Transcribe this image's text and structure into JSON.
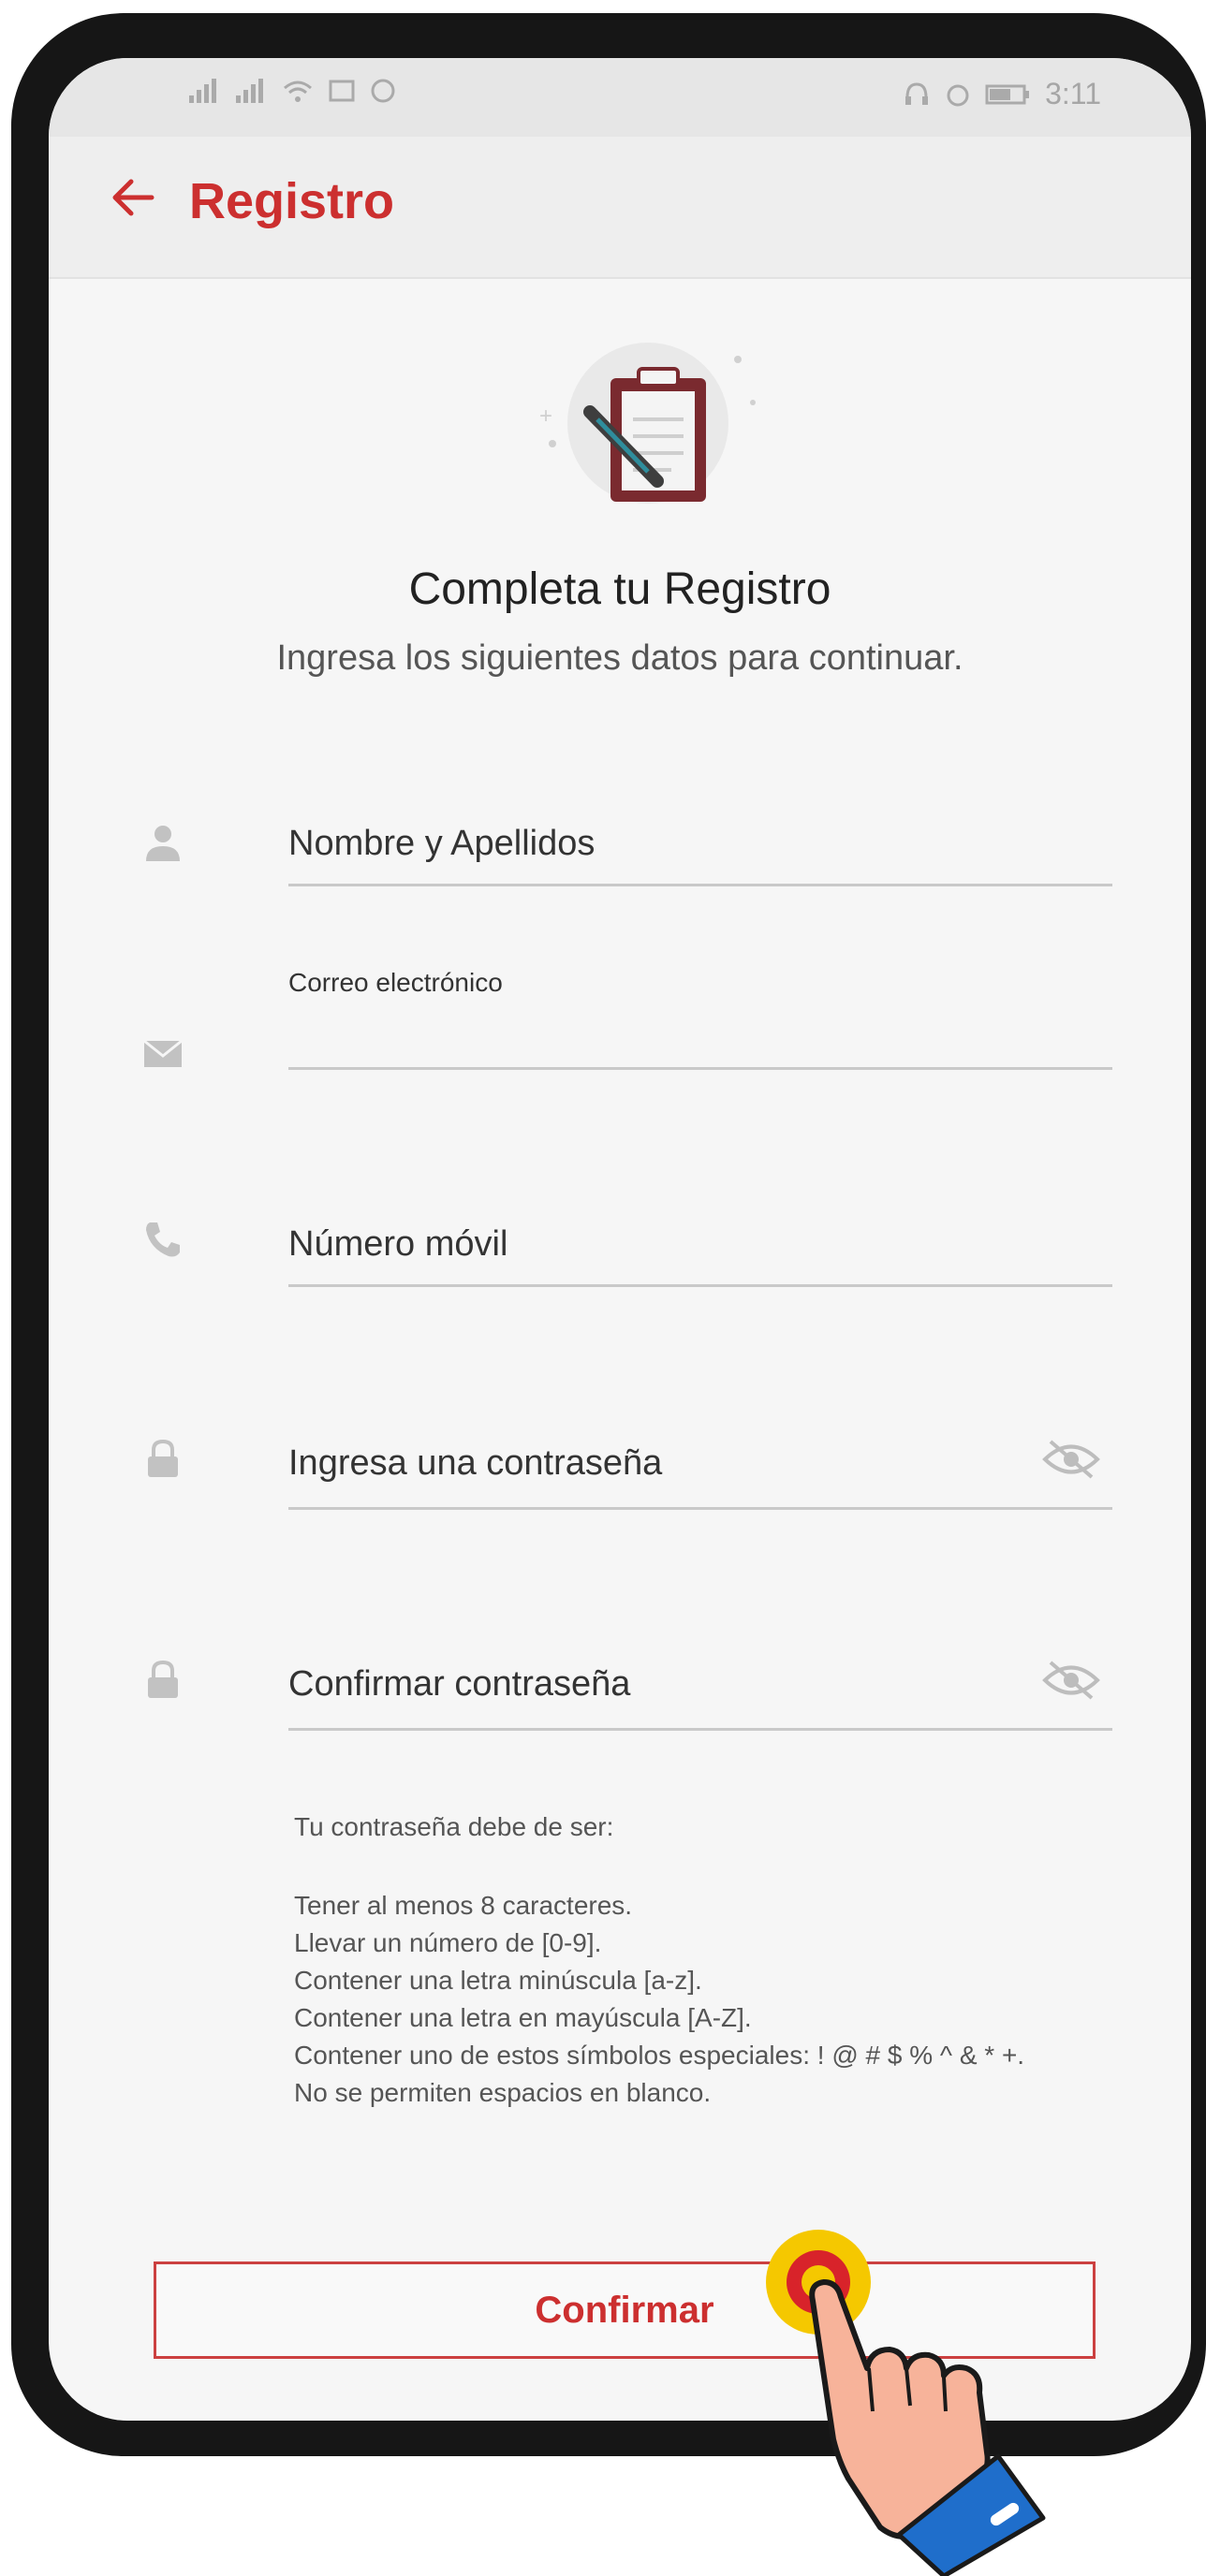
{
  "status_bar": {
    "time": "3:11"
  },
  "app_bar": {
    "title": "Registro"
  },
  "header": {
    "title": "Completa tu Registro",
    "subtitle": "Ingresa los siguientes datos para continuar."
  },
  "form": {
    "name_placeholder": "Nombre y Apellidos",
    "email_label": "Correo electrónico",
    "email_value": "",
    "phone_placeholder": "Número móvil",
    "password_placeholder": "Ingresa una contraseña",
    "confirm_password_placeholder": "Confirmar contraseña"
  },
  "password_rules": {
    "heading": "Tu contraseña debe de ser:",
    "items": [
      "Tener al menos 8 caracteres.",
      "Llevar un número de [0-9].",
      "Contener una letra minúscula [a-z].",
      "Contener una letra en mayúscula [A-Z].",
      "Contener uno de estos símbolos especiales: ! @ # $ % ^ & * +.",
      "No se permiten espacios en blanco."
    ]
  },
  "actions": {
    "confirm_label": "Confirmar"
  },
  "colors": {
    "accent": "#cc2f2f",
    "tap_indicator_outer": "#f5c800",
    "tap_indicator_inner": "#d8232a",
    "cuff": "#1f6ecb"
  },
  "icons": [
    "back-arrow-icon",
    "clipboard-icon",
    "user-icon",
    "mail-icon",
    "phone-icon",
    "lock-icon",
    "eye-off-icon"
  ]
}
